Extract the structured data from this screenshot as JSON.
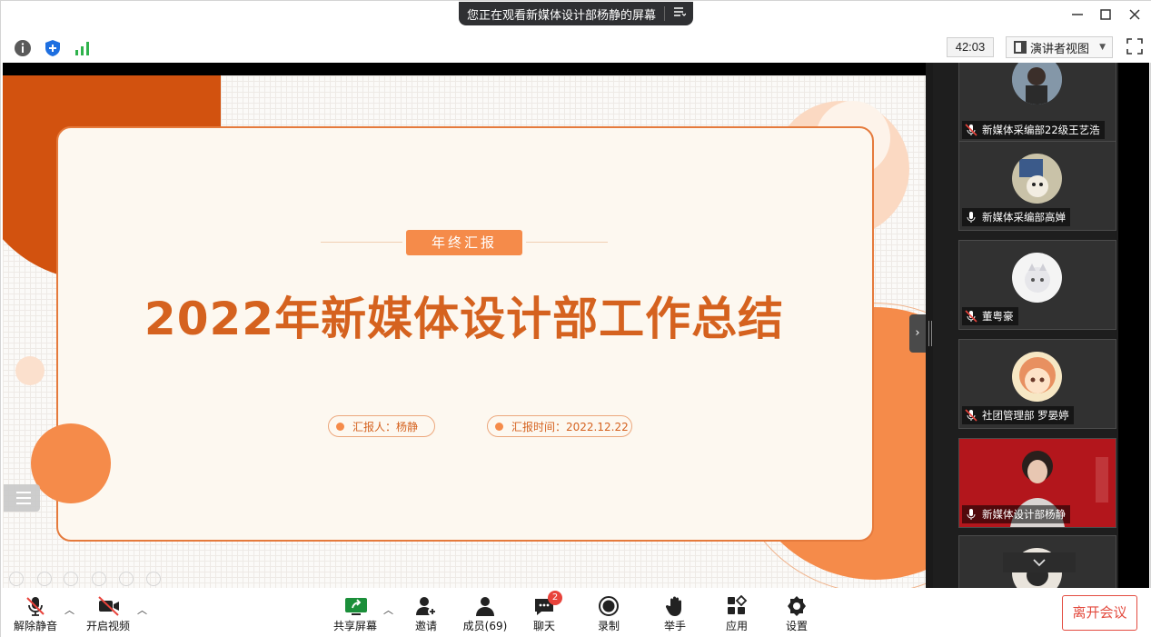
{
  "window": {
    "share_notice": "您正在观看新媒体设计部杨静的屏幕",
    "share_menu_icon": "list-menu-icon",
    "minimize_icon": "minimize-icon",
    "maximize_icon": "maximize-icon",
    "close_icon": "close-icon"
  },
  "toolbar": {
    "timer": "42:03",
    "view_mode": "演讲者视图",
    "icons": [
      "info-icon",
      "shield-icon",
      "signal-icon",
      "fullscreen-icon"
    ]
  },
  "slide": {
    "tag": "年终汇报",
    "headline": "2022年新媒体设计部工作总结",
    "reporter": "汇报人：杨静",
    "report_time": "汇报时间：2022.12.22",
    "colors": {
      "primary": "#d5621f",
      "accent": "#f58b4a",
      "light": "#fbd9c2"
    }
  },
  "participants": [
    {
      "name": "新媒体采编部22级王艺浩",
      "muted": true
    },
    {
      "name": "新媒体采编部高婵",
      "muted": false
    },
    {
      "name": "董粤豪",
      "muted": true
    },
    {
      "name": "社团管理部 罗晏婷",
      "muted": true
    },
    {
      "name": "新媒体设计部杨静",
      "muted": false
    },
    {
      "name": "",
      "muted": false
    }
  ],
  "bottombar": {
    "unmute": "解除静音",
    "start_video": "开启视频",
    "share_screen": "共享屏幕",
    "invite": "邀请",
    "members": "成员(69)",
    "chat": "聊天",
    "chat_badge": "2",
    "record": "录制",
    "raise_hand": "举手",
    "apps": "应用",
    "settings": "设置",
    "leave": "离开会议"
  }
}
